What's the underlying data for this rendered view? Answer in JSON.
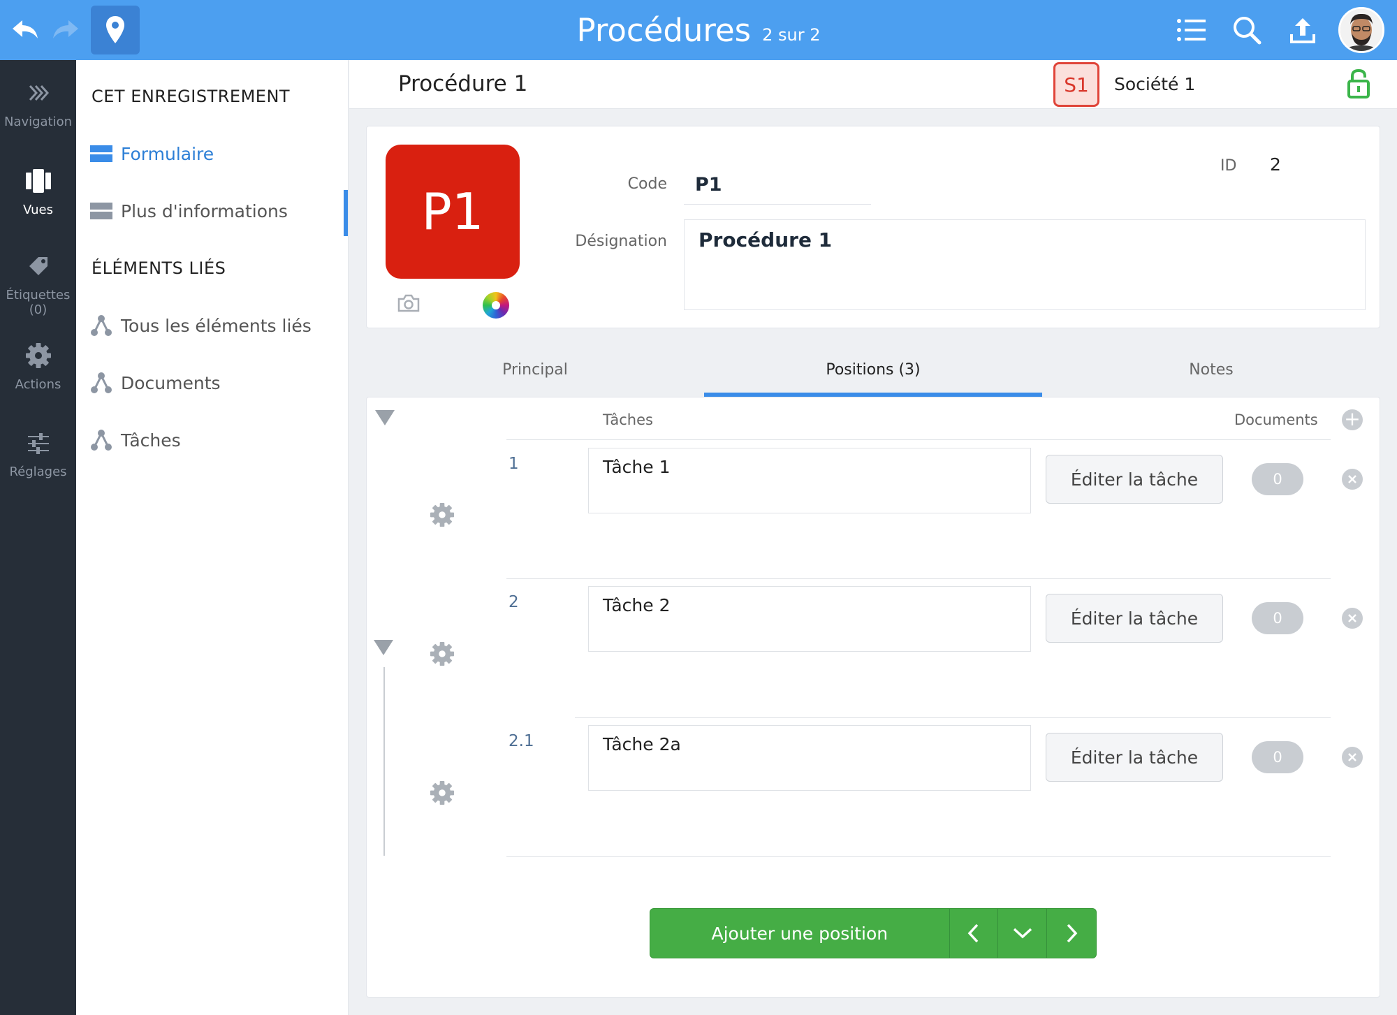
{
  "topbar": {
    "title": "Procédures",
    "counter": "2 sur 2",
    "icons": [
      "undo-icon",
      "redo-icon",
      "map-pin-icon",
      "list-icon",
      "search-icon",
      "upload-icon",
      "user-avatar"
    ]
  },
  "rail": {
    "items": [
      {
        "label": "Navigation",
        "icon": "chevrons-right-icon"
      },
      {
        "label": "Vues",
        "icon": "views-icon",
        "active": true
      },
      {
        "label": "Étiquettes",
        "count": "(0)",
        "icon": "tag-icon"
      },
      {
        "label": "Actions",
        "icon": "gear-icon"
      },
      {
        "label": "Réglages",
        "icon": "sliders-icon"
      }
    ]
  },
  "sidepanel": {
    "record_heading": "CET ENREGISTREMENT",
    "record_items": [
      {
        "label": "Formulaire",
        "active": true,
        "icon": "form-icon"
      },
      {
        "label": "Plus d'informations",
        "icon": "form-icon"
      }
    ],
    "linked_heading": "ÉLÉMENTS LIÉS",
    "linked_items": [
      {
        "label": "Tous les éléments liés",
        "icon": "linked-icon"
      },
      {
        "label": "Documents",
        "icon": "linked-icon"
      },
      {
        "label": "Tâches",
        "icon": "linked-icon"
      }
    ]
  },
  "record": {
    "title": "Procédure 1",
    "company_badge": "S1",
    "company_name": "Société 1"
  },
  "form": {
    "tile_text": "P1",
    "code_label": "Code",
    "code_value": "P1",
    "designation_label": "Désignation",
    "designation_value": "Procédure 1",
    "id_label": "ID",
    "id_value": "2"
  },
  "tabs": [
    {
      "label": "Principal"
    },
    {
      "label": "Positions (3)",
      "active": true
    },
    {
      "label": "Notes"
    }
  ],
  "positions": {
    "col_tasks": "Tâches",
    "col_documents": "Documents",
    "rows": [
      {
        "num": "1",
        "task": "Tâche 1",
        "edit_label": "Éditer la tâche",
        "doc_count": "0"
      },
      {
        "num": "2",
        "task": "Tâche 2",
        "edit_label": "Éditer la tâche",
        "doc_count": "0"
      },
      {
        "num": "2.1",
        "task": "Tâche 2a",
        "edit_label": "Éditer la tâche",
        "doc_count": "0"
      }
    ]
  },
  "actions": {
    "add_position_label": "Ajouter une position"
  },
  "colors": {
    "topbar": "#4c9ff0",
    "rail": "#262e38",
    "accent": "#3a8ce8",
    "tile": "#d92010",
    "add_button": "#45ad45",
    "lock": "#3bb54a"
  }
}
